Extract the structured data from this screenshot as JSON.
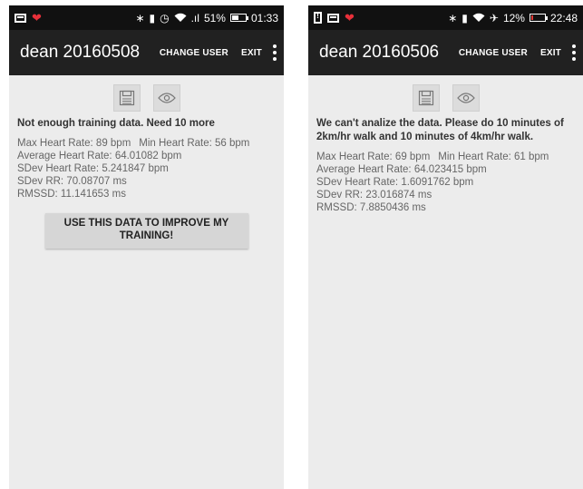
{
  "left": {
    "statusbar": {
      "time": "01:33",
      "battery_percent": "51%",
      "signal_text": ".ıl",
      "battery_level": 0.51
    },
    "appbar": {
      "title": "dean 20160508",
      "change_user": "CHANGE USER",
      "exit": "EXIT"
    },
    "message": "Not enough training data. Need 10 more",
    "stats": {
      "max_hr": "Max Heart Rate: 89 bpm",
      "min_hr": "Min Heart Rate: 56 bpm",
      "avg_hr": "Average Heart Rate: 64.01082 bpm",
      "sdev_hr": "SDev Heart Rate: 5.241847 bpm",
      "sdev_rr": "SDev RR: 70.08707 ms",
      "rmssd": "RMSSD: 11.141653 ms"
    },
    "use_button": "USE THIS DATA TO IMPROVE MY TRAINING!"
  },
  "right": {
    "statusbar": {
      "time": "22:48",
      "battery_percent": "12%",
      "battery_level": 0.12
    },
    "appbar": {
      "title": "dean 20160506",
      "change_user": "CHANGE USER",
      "exit": "EXIT"
    },
    "message": "We can't analize the data. Please do 10 minutes of 2km/hr walk and 10 minutes of 4km/hr walk.",
    "stats": {
      "max_hr": "Max Heart Rate: 69 bpm",
      "min_hr": "Min Heart Rate: 61 bpm",
      "avg_hr": "Average Heart Rate: 64.023415 bpm",
      "sdev_hr": "SDev Heart Rate: 1.6091762 bpm",
      "sdev_rr": "SDev RR: 23.016874 ms",
      "rmssd": "RMSSD: 7.8850436 ms"
    }
  },
  "icons": {
    "save": "floppy-disk-icon",
    "view": "eye-icon",
    "heart": "heart-icon",
    "bluetooth": "bluetooth-icon",
    "vibrate": "vibrate-icon",
    "alarm": "alarm-icon",
    "wifi": "wifi-icon",
    "airplane": "airplane-icon",
    "overflow": "overflow-menu-icon"
  },
  "colors": {
    "appbar": "#212121",
    "statusbar": "#111111",
    "background": "#ececec",
    "heart": "#e8303a",
    "battery_low": "#e53935"
  }
}
